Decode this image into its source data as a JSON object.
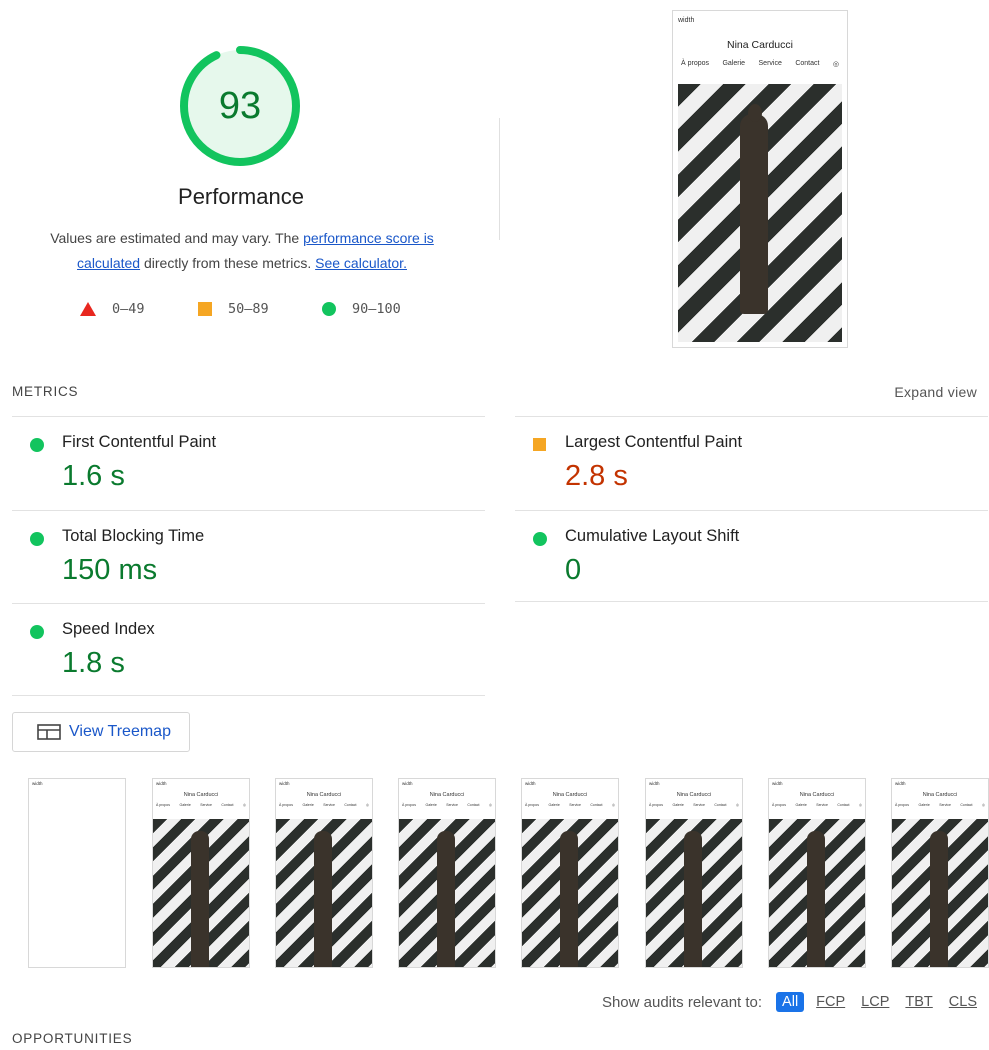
{
  "performance": {
    "score": "93",
    "score_fraction": 0.93,
    "title": "Performance",
    "desc_prefix": "Values are estimated and may vary. The ",
    "link_score": "performance score is calculated",
    "desc_middle": " directly from these metrics. ",
    "link_calculator": "See calculator.",
    "legend": [
      {
        "range": "0–49",
        "icon": "triangle-icon",
        "color": "#e8271f"
      },
      {
        "range": "50–89",
        "icon": "square-icon",
        "color": "#f5a623"
      },
      {
        "range": "90–100",
        "icon": "circle-icon",
        "color": "#12c45e"
      }
    ]
  },
  "final_screenshot": {
    "tiny_text": "width",
    "site_name": "Nina Carducci",
    "nav": [
      "À propos",
      "Galerie",
      "Service",
      "Contact",
      "◎"
    ]
  },
  "metrics": {
    "header": "METRICS",
    "expand_view": "Expand view",
    "items": [
      {
        "label": "First Contentful Paint",
        "value": "1.6 s",
        "status": "good"
      },
      {
        "label": "Largest Contentful Paint",
        "value": "2.8 s",
        "status": "average"
      },
      {
        "label": "Total Blocking Time",
        "value": "150 ms",
        "status": "good"
      },
      {
        "label": "Cumulative Layout Shift",
        "value": "0",
        "status": "good"
      },
      {
        "label": "Speed Index",
        "value": "1.8 s",
        "status": "good"
      }
    ]
  },
  "treemap": {
    "label": "View Treemap",
    "icon": "treemap-icon"
  },
  "filmstrip": {
    "tiny_text": "width",
    "site_name": "Nina Carducci",
    "nav": [
      "À propos",
      "Galerie",
      "Service",
      "Contact",
      "◎"
    ]
  },
  "filters": {
    "label": "Show audits relevant to:",
    "chips": [
      "All",
      "FCP",
      "LCP",
      "TBT",
      "CLS"
    ]
  },
  "opportunities": {
    "header": "OPPORTUNITIES"
  },
  "colors": {
    "pass": "#12c45e",
    "average": "#f5a623",
    "fail": "#e8271f",
    "link": "#1a57c9"
  }
}
